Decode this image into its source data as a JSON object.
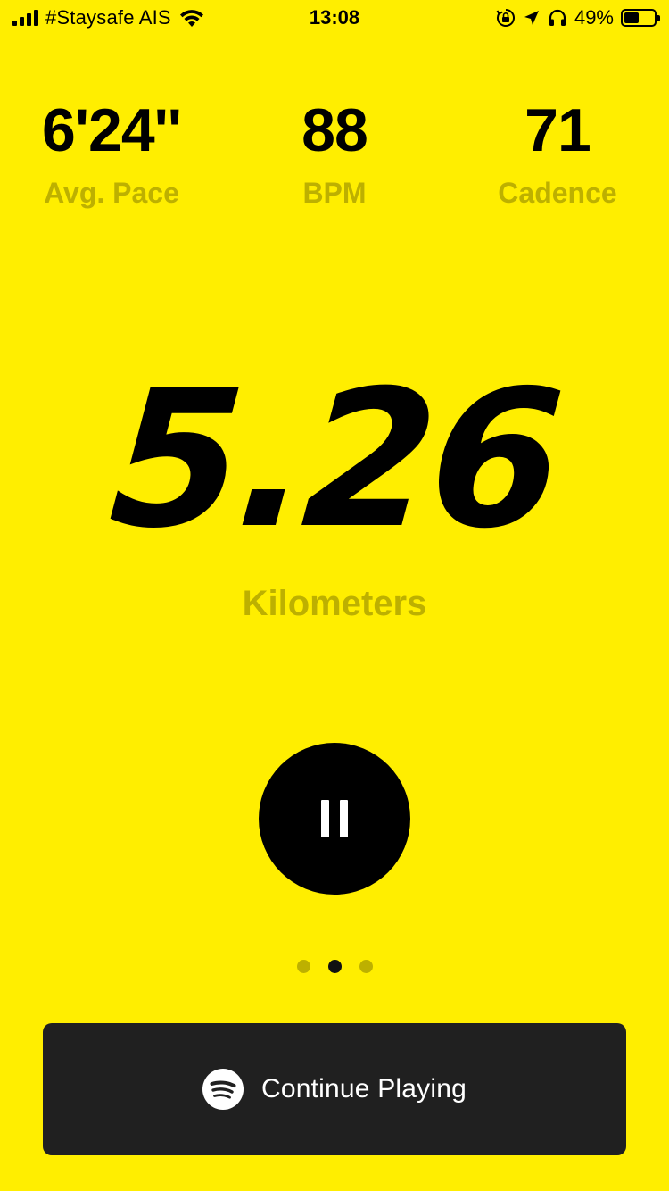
{
  "status_bar": {
    "carrier": "#Staysafe AIS",
    "time": "13:08",
    "battery_percent": "49%",
    "battery_level": 0.49,
    "icons": [
      "signal-icon",
      "wifi-icon",
      "orientation-lock-icon",
      "location-arrow-icon",
      "headphones-icon",
      "battery-icon"
    ]
  },
  "stats": [
    {
      "value": "6'24''",
      "label": "Avg. Pace"
    },
    {
      "value": "88",
      "label": "BPM"
    },
    {
      "value": "71",
      "label": "Cadence"
    }
  ],
  "distance": {
    "value": "5.26",
    "unit": "Kilometers"
  },
  "controls": {
    "pause_icon": "pause-icon"
  },
  "pager": {
    "count": 3,
    "active_index": 1
  },
  "music": {
    "label": "Continue Playing",
    "icon": "spotify-icon"
  },
  "colors": {
    "background": "#FFEE00",
    "muted_label": "#BDB000",
    "button_dark": "#202020"
  }
}
